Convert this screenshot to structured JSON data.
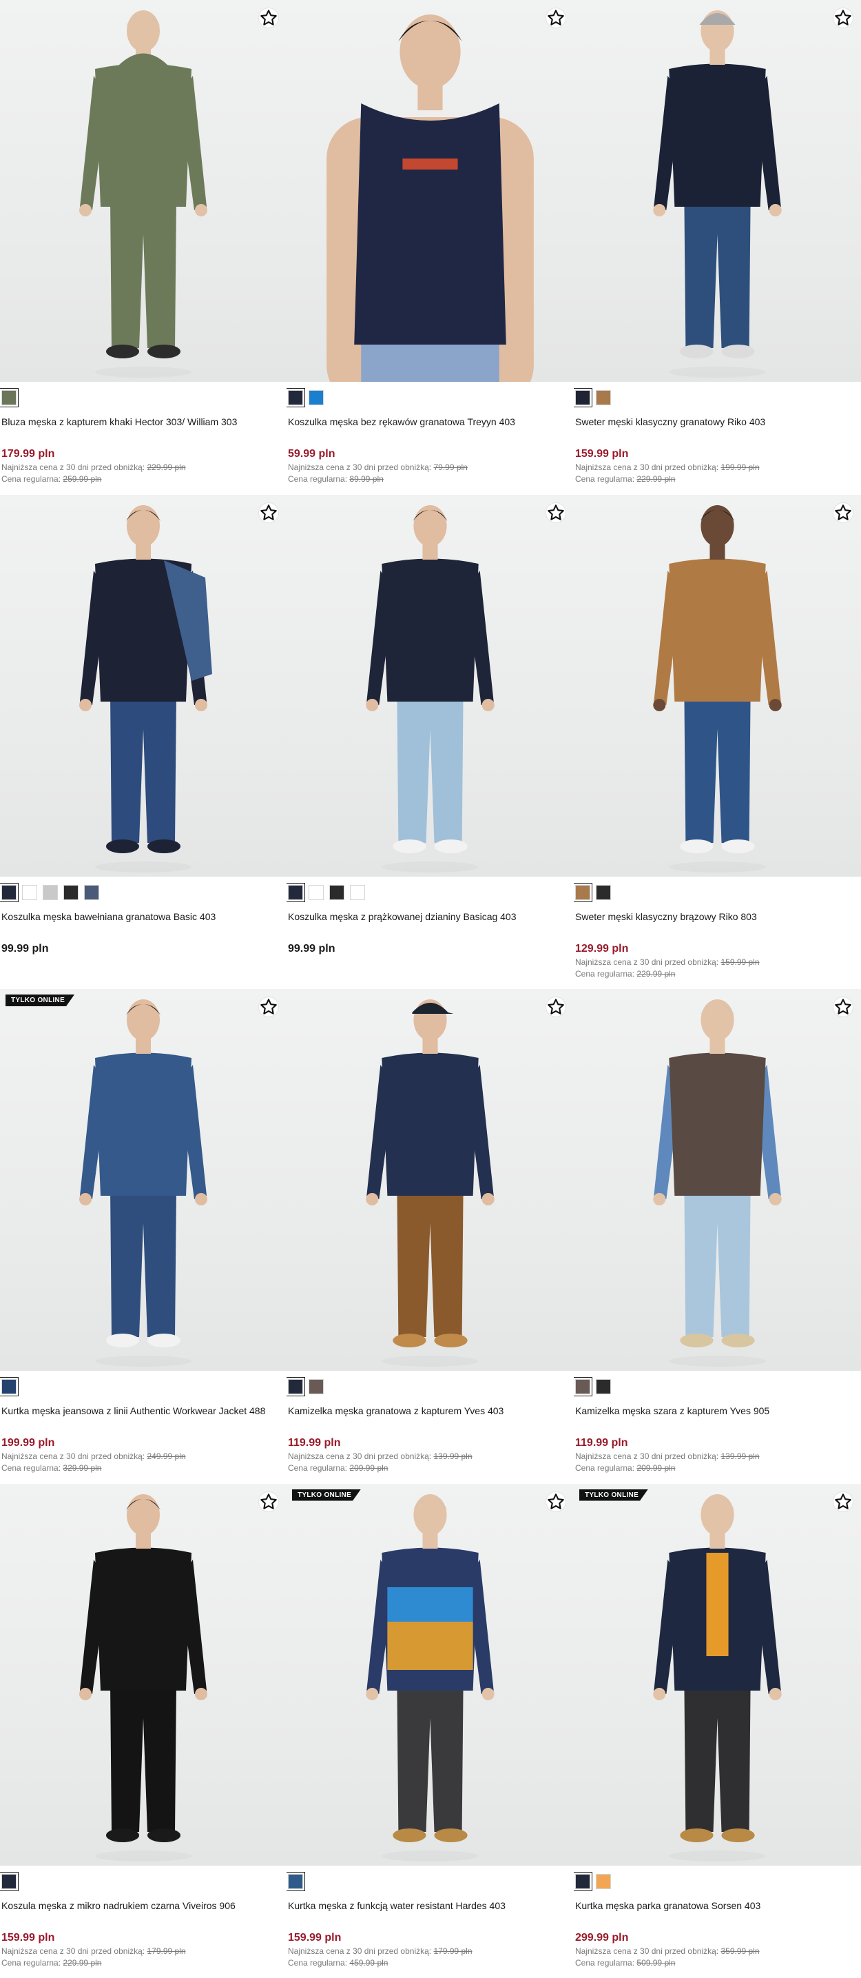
{
  "labels": {
    "lowest_price_label": "Najniższa cena z 30 dni przed obniżką:",
    "regular_price_label": "Cena regularna:",
    "online_badge": "TYLKO ONLINE"
  },
  "colors": {
    "sale_price": "#9a1a2a",
    "regular_price": "#1a1a1a"
  },
  "products": [
    {
      "name": "Bluza męska z kapturem khaki Hector 303/ William 303",
      "price": "179.99 pln",
      "sale": true,
      "lowest": "229.99 pln",
      "regular": "259.99 pln",
      "swatches": [
        "#6b7558"
      ],
      "badge": false,
      "figure": {
        "top": "#6c7a5a",
        "bottom": "#6c7a5a",
        "skin": "#e2c2a6",
        "hair": "#cfc3b4",
        "shoes": "#2c2c2c",
        "hood": true
      }
    },
    {
      "name": "Koszulka męska bez rękawów granatowa Treyyn 403",
      "price": "59.99 pln",
      "sale": true,
      "lowest": "79.99 pln",
      "regular": "89.99 pln",
      "swatches": [
        "#22293a",
        "#1b7fd0"
      ],
      "badge": false,
      "figure": {
        "top": "#1f2744",
        "bottom": "#8aa5c9",
        "skin": "#e0bca0",
        "hair": "#1c1a1a",
        "shoes": "#2c2c2c",
        "closeup": true
      }
    },
    {
      "name": "Sweter męski klasyczny granatowy Riko 403",
      "price": "159.99 pln",
      "sale": true,
      "lowest": "199.99 pln",
      "regular": "229.99 pln",
      "swatches": [
        "#1e2433",
        "#a8794a"
      ],
      "badge": false,
      "figure": {
        "top": "#1b2236",
        "bottom": "#2e4f7c",
        "skin": "#e3c3a8",
        "hair": "#9a9a9a",
        "shoes": "#dcdcdc",
        "beanie": true
      }
    },
    {
      "name": "Koszulka męska bawełniana granatowa Basic 403",
      "price": "99.99 pln",
      "sale": false,
      "lowest": "",
      "regular": "",
      "swatches": [
        "#22293a",
        "#ffffff",
        "#c9c9c9",
        "#2b2b2b",
        "#4a5a78"
      ],
      "badge": false,
      "figure": {
        "top": "#1d2235",
        "bottom": "#2d4b7c",
        "skin": "#e0bca0",
        "hair": "#1c1a1a",
        "shoes": "#1d2235",
        "jacket": "#3f5f8c"
      }
    },
    {
      "name": "Koszulka męska z prążkowanej dzianiny Basicag 403",
      "price": "99.99 pln",
      "sale": false,
      "lowest": "",
      "regular": "",
      "swatches": [
        "#22293a",
        "#ffffff",
        "#2b2b2b",
        "#ffffff"
      ],
      "badge": false,
      "figure": {
        "top": "#1f2538",
        "bottom": "#9fc0d8",
        "skin": "#e0bca0",
        "hair": "#1c1a1a",
        "shoes": "#f2f2f2"
      }
    },
    {
      "name": "Sweter męski klasyczny brązowy Riko 803",
      "price": "129.99 pln",
      "sale": true,
      "lowest": "159.99 pln",
      "regular": "229.99 pln",
      "swatches": [
        "#a8794a",
        "#2b2b2b"
      ],
      "badge": false,
      "figure": {
        "top": "#b07a45",
        "bottom": "#2f5588",
        "skin": "#6a4a37",
        "hair": "#1c1a1a",
        "shoes": "#f2f2f2"
      }
    },
    {
      "name": "Kurtka męska jeansowa z linii Authentic Workwear Jacket 488",
      "price": "199.99 pln",
      "sale": true,
      "lowest": "249.99 pln",
      "regular": "329.99 pln",
      "swatches": [
        "#24426e"
      ],
      "badge": true,
      "figure": {
        "top": "#34598a",
        "bottom": "#2f4e7d",
        "skin": "#e0bca0",
        "hair": "#1c1a1a",
        "shoes": "#f2f2f2"
      }
    },
    {
      "name": "Kamizelka męska granatowa z kapturem Yves 403",
      "price": "119.99 pln",
      "sale": true,
      "lowest": "139.99 pln",
      "regular": "209.99 pln",
      "swatches": [
        "#22293a",
        "#6a5a55"
      ],
      "badge": false,
      "figure": {
        "top": "#23304f",
        "bottom": "#8a5a2c",
        "skin": "#e0bca0",
        "hair": "#1c2430",
        "shoes": "#c08a4a",
        "cap": true
      }
    },
    {
      "name": "Kamizelka męska szara z kapturem Yves 905",
      "price": "119.99 pln",
      "sale": true,
      "lowest": "139.99 pln",
      "regular": "209.99 pln",
      "swatches": [
        "#6a5a55",
        "#2b2b2b"
      ],
      "badge": false,
      "figure": {
        "top": "#5a4a44",
        "bottom": "#a9c6dd",
        "skin": "#e3c3a8",
        "hair": "#cfc3b4",
        "shoes": "#d8c6a0",
        "sleeves": "#5f89bc"
      }
    },
    {
      "name": "Koszula męska z mikro nadrukiem czarna Viveiros 906",
      "price": "159.99 pln",
      "sale": true,
      "lowest": "179.99 pln",
      "regular": "229.99 pln",
      "swatches": [
        "#22293a"
      ],
      "badge": false,
      "figure": {
        "top": "#161616",
        "bottom": "#141414",
        "skin": "#e0bca0",
        "hair": "#2a1e18",
        "shoes": "#1a1a1a"
      }
    },
    {
      "name": "Kurtka męska z funkcją water resistant Hardes 403",
      "price": "159.99 pln",
      "sale": true,
      "lowest": "179.99 pln",
      "regular": "459.99 pln",
      "swatches": [
        "#2f5a8a"
      ],
      "badge": true,
      "figure": {
        "top": "#2a3b67",
        "bottom": "#3a3a3c",
        "skin": "#e3c3a8",
        "hair": "#cfc3b4",
        "shoes": "#b88a45",
        "blocks": true
      }
    },
    {
      "name": "Kurtka męska parka granatowa Sorsen 403",
      "price": "299.99 pln",
      "sale": true,
      "lowest": "359.99 pln",
      "regular": "509.99 pln",
      "swatches": [
        "#22293a",
        "#f2a653"
      ],
      "badge": true,
      "figure": {
        "top": "#1e2840",
        "bottom": "#2f2f31",
        "skin": "#e3c3a8",
        "hair": "#cfc3b4",
        "shoes": "#b88a45",
        "inner": "#e59a2a"
      }
    }
  ]
}
